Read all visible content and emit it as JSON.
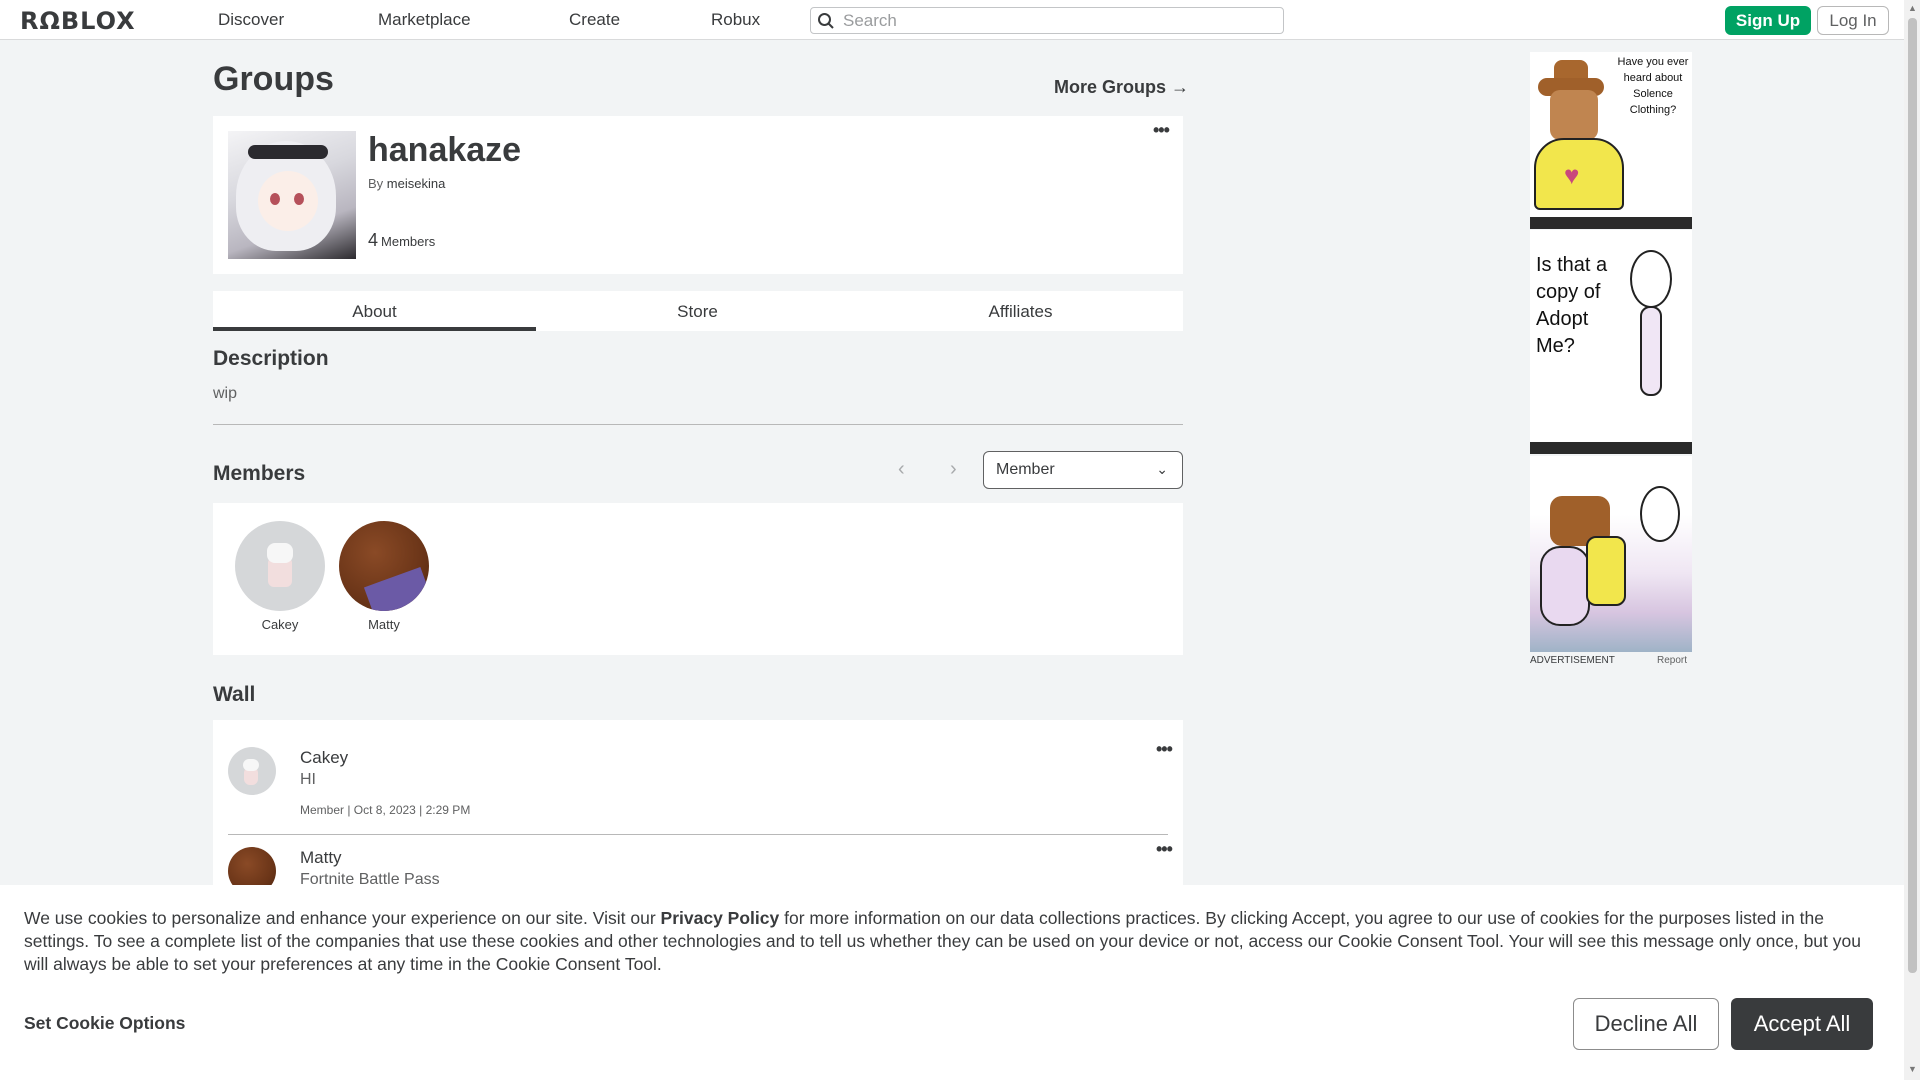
{
  "header": {
    "logo": "RΩBLOX",
    "nav": [
      "Discover",
      "Marketplace",
      "Create",
      "Robux"
    ],
    "search_placeholder": "Search",
    "signup_label": "Sign Up",
    "login_label": "Log In"
  },
  "page": {
    "title": "Groups",
    "more_groups": "More Groups →"
  },
  "group": {
    "name": "hanakaze",
    "by_prefix": "By",
    "owner": "meisekina",
    "member_count": "4",
    "member_label": "Members",
    "menu_glyph": "•••"
  },
  "tabs": [
    "About",
    "Store",
    "Affiliates"
  ],
  "about": {
    "description_title": "Description",
    "description_text": "wip"
  },
  "members_section": {
    "title": "Members",
    "prev_glyph": "‹",
    "next_glyph": "›",
    "role_selected": "Member",
    "role_chevron": "⌄",
    "members": [
      {
        "name": "Cakey"
      },
      {
        "name": "Matty"
      }
    ]
  },
  "wall": {
    "title": "Wall",
    "posts": [
      {
        "author": "Cakey",
        "body": "HI",
        "meta": "Member | Oct 8, 2023 | 2:29 PM"
      },
      {
        "author": "Matty",
        "body": "Fortnite Battle Pass",
        "meta": ""
      }
    ]
  },
  "ads": {
    "ad1_text": "Have you ever heard about Solence Clothing?",
    "ad2_text": "Is that a copy of Adopt Me?",
    "label": "ADVERTISEMENT",
    "report": "Report"
  },
  "cookie_banner": {
    "text_before": "We use cookies to personalize and enhance your experience on our site. Visit our ",
    "privacy_link": "Privacy Policy",
    "text_after": " for more information on our data collections practices. By clicking Accept, you agree to our use of cookies for the purposes listed in the settings. To see a complete list of the companies that use these cookies and other technologies and to tell us whether they can be used on your device or not, access our Cookie Consent Tool. Your will see this message only once, but you will always be able to set your preferences at any time in the Cookie Consent Tool.",
    "set_options": "Set Cookie Options",
    "decline": "Decline All",
    "accept": "Accept All"
  },
  "colors": {
    "signup_green": "#00a263",
    "accept_dark": "#393b3d",
    "page_bg": "#f2f4f5"
  }
}
